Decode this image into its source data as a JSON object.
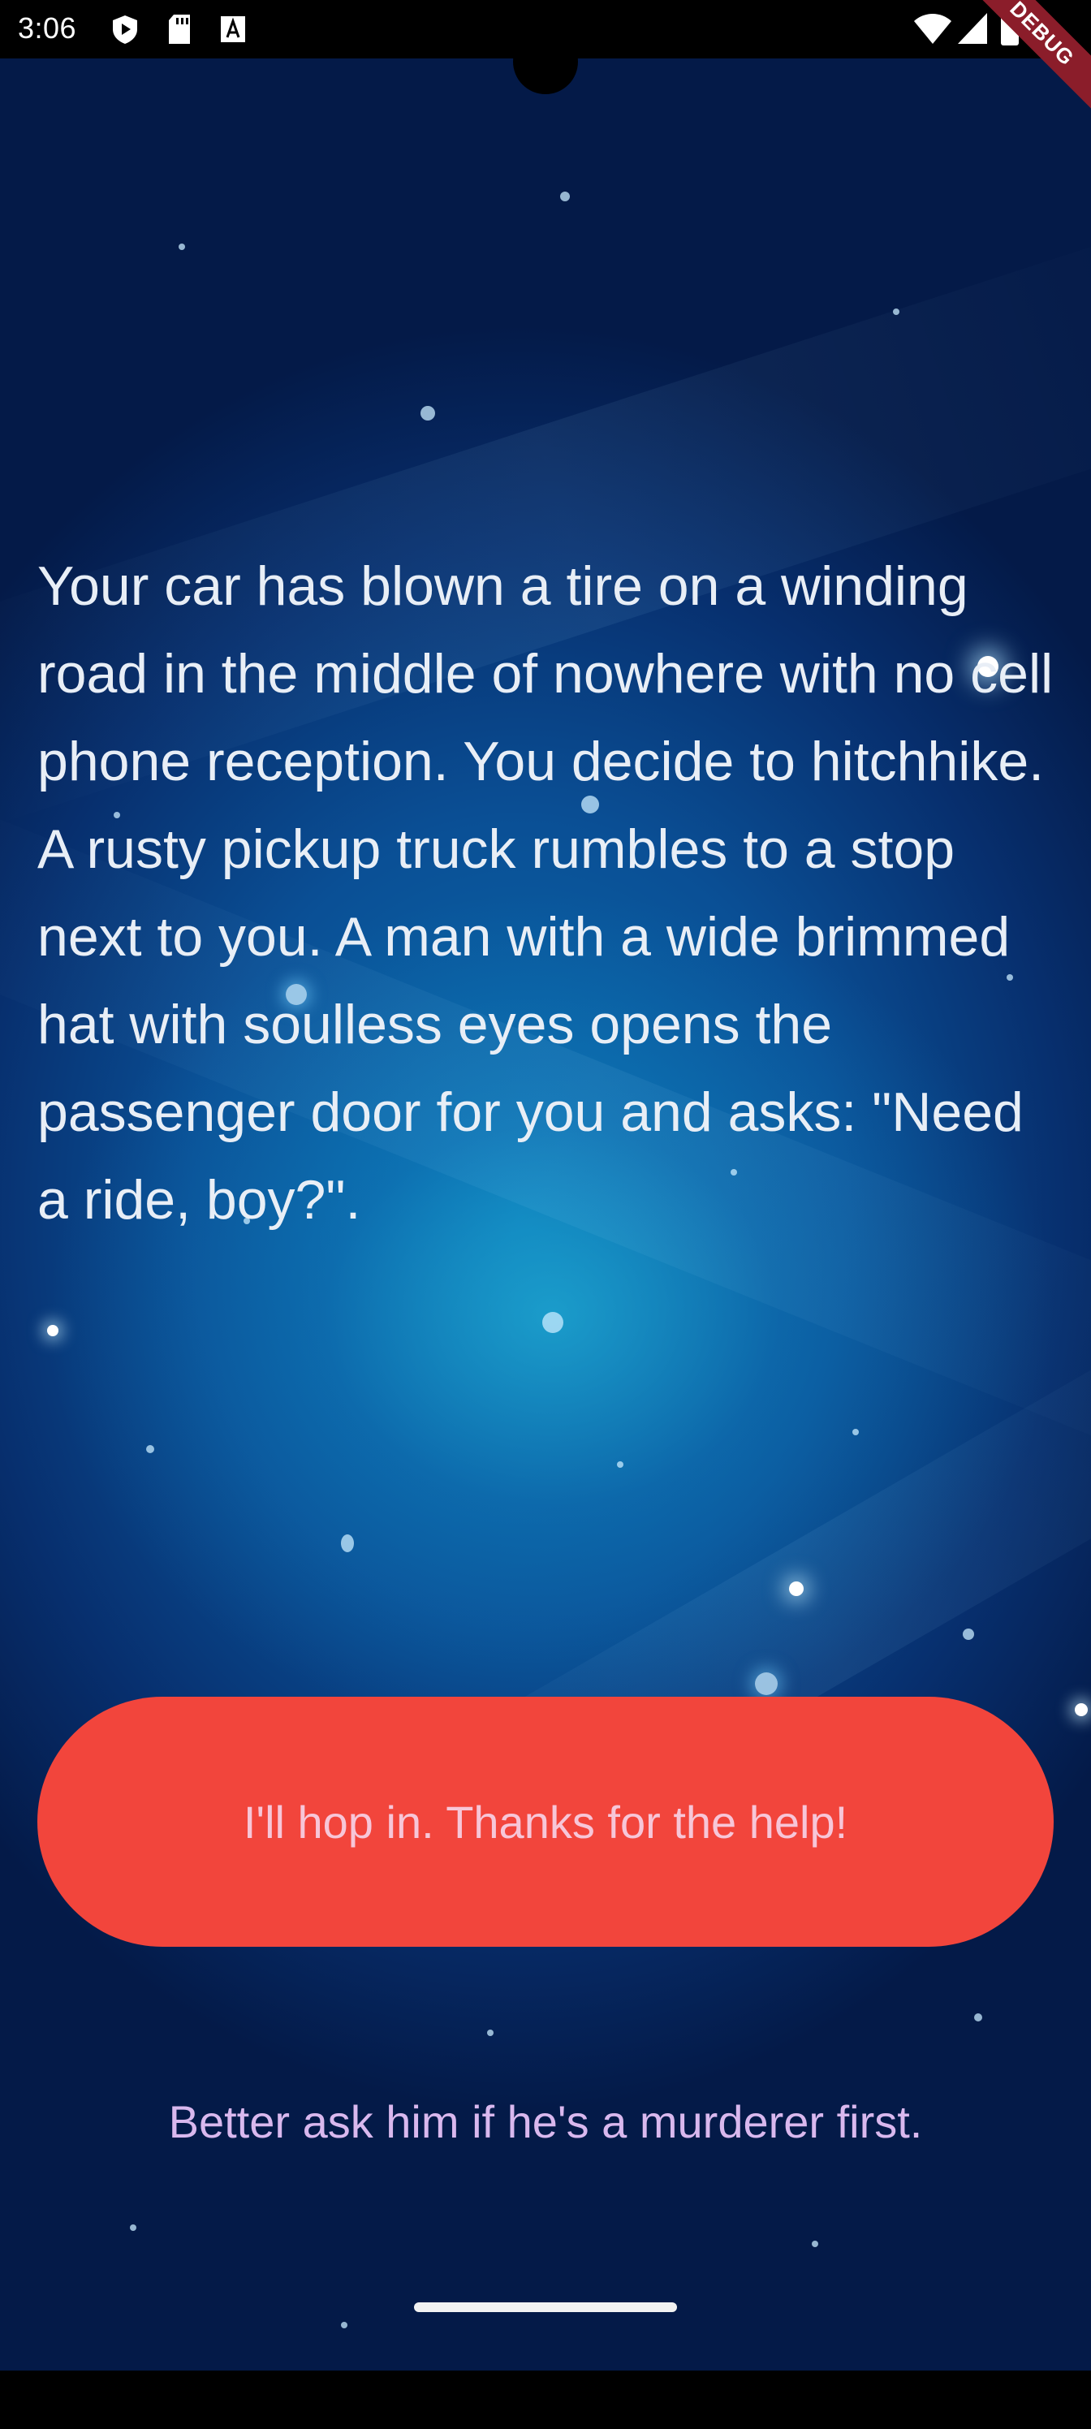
{
  "status_bar": {
    "time": "3:06",
    "debug_label": "DEBUG"
  },
  "story": {
    "text": "Your car has blown a tire on a winding road in the middle of nowhere with no cell phone reception. You decide to hitchhike. A rusty pickup truck rumbles to a stop next to you. A man with a wide brimmed hat with soulless eyes opens the passenger door for you and asks: \"Need a ride, boy?\"."
  },
  "choices": {
    "primary_label": "I'll hop in. Thanks for the help!",
    "secondary_label": "Better ask him if he's a murderer first."
  },
  "colors": {
    "primary_button": "#f2453c",
    "primary_text": "#f7c6d8",
    "secondary_text": "#d9b8ee",
    "story_text": "#e8eef6"
  },
  "icons": {
    "status_left": [
      "play-protect-icon",
      "sd-card-icon",
      "accessibility-icon"
    ],
    "status_right": [
      "wifi-icon",
      "signal-icon",
      "battery-icon"
    ]
  }
}
